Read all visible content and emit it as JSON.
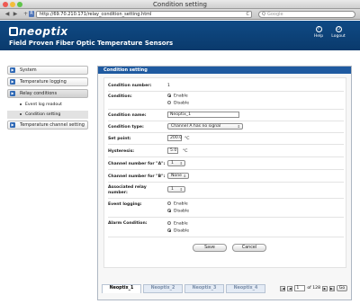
{
  "window": {
    "title": "Condition setting"
  },
  "browser": {
    "url": "http://69.70.210.171/relay_condition_setting.html",
    "search_placeholder": "Google",
    "back_label": "◀",
    "forward_label": "▶",
    "add_label": "+",
    "rss_label": "R",
    "reload_label": "C",
    "search_icon_label": "Q"
  },
  "header": {
    "logo_text": "neoptix",
    "tagline_plain": "Field Proven ",
    "tagline_bold": "Fiber Optic Temperature Sensors",
    "help_label": "Help",
    "logout_label": "Logout",
    "help_icon": "?",
    "logout_icon": "⏻"
  },
  "sidebar": {
    "items": [
      {
        "label": "System"
      },
      {
        "label": "Temperature logging"
      },
      {
        "label": "Relay conditions"
      },
      {
        "label": "Temperature channel setting"
      }
    ],
    "subitems": [
      {
        "label": "Event log readout"
      },
      {
        "label": "Condition setting"
      }
    ],
    "arrow_glyph": "▶"
  },
  "main": {
    "title": "Condition setting",
    "condition_number_label": "Condition number:",
    "condition_number_value": "1",
    "condition_label": "Condition:",
    "condition_options": [
      "Enable",
      "Disable"
    ],
    "condition_name_label": "Condition name:",
    "condition_name_value": "Neoptix_1",
    "condition_type_label": "Condition type:",
    "condition_type_value": "Channel A has no signal",
    "set_point_label": "Set point:",
    "set_point_value": "200.0",
    "set_point_unit": "°C",
    "hysteresis_label": "Hysteresis:",
    "hysteresis_value": "5.0",
    "hysteresis_unit": "°C",
    "channel_a_label": "Channel number for \"A\":",
    "channel_a_value": "1",
    "channel_b_label": "Channel number for \"B\":",
    "channel_b_value": "None",
    "relay_label_1": "Associated relay",
    "relay_label_2": "number:",
    "relay_value": "1",
    "event_logging_label": "Event logging:",
    "event_logging_options": [
      "Enable",
      "Disable"
    ],
    "alarm_condition_label": "Alarm Condition:",
    "alarm_condition_options": [
      "Enable",
      "Disable"
    ],
    "save_label": "Save",
    "cancel_label": "Cancel",
    "caret_glyph": "⇕",
    "tabs": [
      "Neoptix_1",
      "Neoptix_2",
      "Neoptix_3",
      "Neoptix_4"
    ],
    "pager": {
      "first": "|◀",
      "prev": "◀",
      "page": "1",
      "of_text": "of 128",
      "next": "▶",
      "last": "▶|",
      "go_label": "Go"
    }
  }
}
